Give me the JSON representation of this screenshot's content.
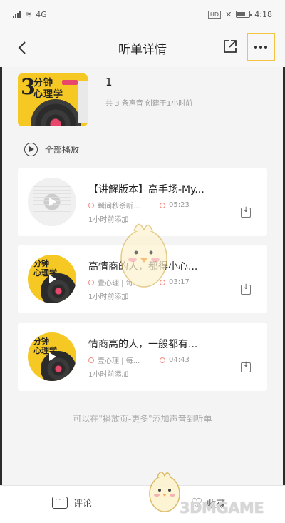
{
  "status_bar": {
    "left_icons": [
      "signal-icon",
      "wifi-icon",
      "network-4g-label"
    ],
    "network_label": "4G",
    "time": "4:18",
    "right_icons": [
      "hd-icon",
      "mute-icon",
      "battery-icon"
    ],
    "hd_label": "HD"
  },
  "header": {
    "title": "听单详情",
    "back_icon": "chevron-left-icon",
    "share_icon": "share-icon",
    "more_icon": "more-icon"
  },
  "playlist": {
    "cover_number": "3",
    "cover_text_line1": "分钟",
    "cover_text_line2": "心理学",
    "name": "1",
    "meta": "共 3 条声音  创建于1小时前"
  },
  "play_all": {
    "label": "全部播放",
    "icon": "play-circle-icon"
  },
  "tracks": [
    {
      "title": "【讲解版本】高手场-My...",
      "author": "瞬间秒杀听...",
      "duration": "05:23",
      "added": "1小时前添加",
      "thumb": "doc"
    },
    {
      "title": "高情商的人，都得小心...",
      "author": "壹心理 | 每...",
      "duration": "03:17",
      "added": "1小时前添加",
      "thumb": "yellow"
    },
    {
      "title": "情商高的人，一般都有...",
      "author": "壹心理 | 每...",
      "duration": "04:43",
      "added": "1小时前添加",
      "thumb": "yellow"
    }
  ],
  "hint": "可以在\"播放页-更多\"添加声音到听单",
  "bottom_bar": {
    "comment_label": "评论",
    "comment_icon": "comment-icon",
    "collect_label": "收藏",
    "collect_icon": "heart-icon"
  },
  "watermark": "3DMGAME"
}
